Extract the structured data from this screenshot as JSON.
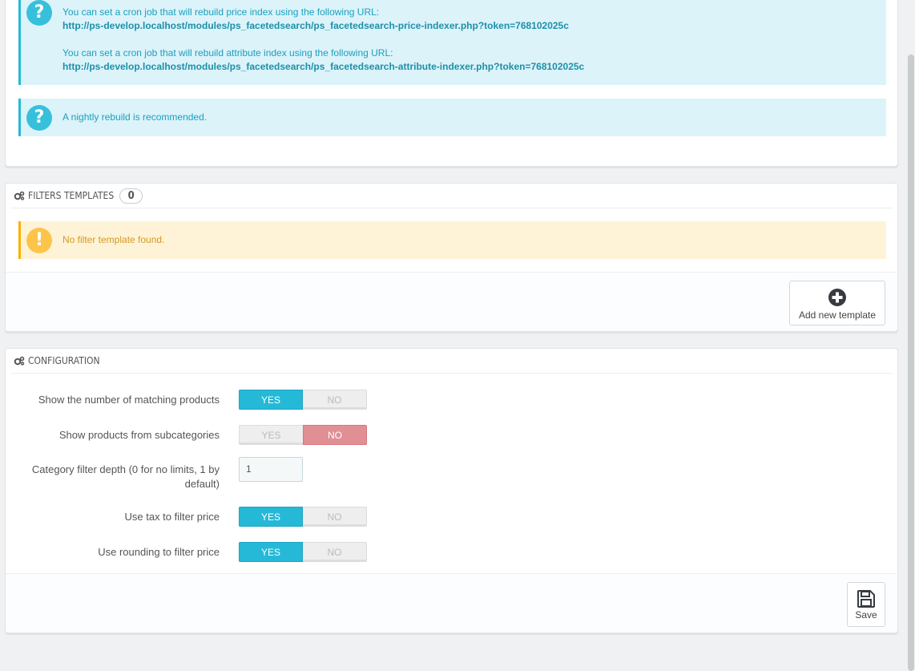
{
  "cron_panel": {
    "alert1": {
      "icon": "question-icon",
      "line1": "You can set a cron job that will rebuild price index using the following URL:",
      "url1": "http://ps-develop.localhost/modules/ps_facetedsearch/ps_facetedsearch-price-indexer.php?token=768102025c",
      "line2": "You can set a cron job that will rebuild attribute index using the following URL:",
      "url2": "http://ps-develop.localhost/modules/ps_facetedsearch/ps_facetedsearch-attribute-indexer.php?token=768102025c"
    },
    "alert2": {
      "icon": "question-icon",
      "text": "A nightly rebuild is recommended."
    }
  },
  "filters_panel": {
    "title": "Filters templates",
    "count": "0",
    "warning": "No filter template found.",
    "add_button_label": "Add new template"
  },
  "config_panel": {
    "title": "Configuration",
    "rows": [
      {
        "label": "Show the number of matching products",
        "type": "switch",
        "value": "yes"
      },
      {
        "label": "Show products from subcategories",
        "type": "switch",
        "value": "no"
      },
      {
        "label": "Category filter depth (0 for no limits, 1 by default)",
        "type": "text",
        "value": "1"
      },
      {
        "label": "Use tax to filter price",
        "type": "switch",
        "value": "yes"
      },
      {
        "label": "Use rounding to filter price",
        "type": "switch",
        "value": "yes"
      }
    ],
    "yes_label": "YES",
    "no_label": "NO",
    "save_label": "Save"
  },
  "colors": {
    "accent": "#25b9d7",
    "danger_soft": "#e08f95",
    "info_bg": "#dcf3fa",
    "warning_bg": "#fff3d7"
  }
}
